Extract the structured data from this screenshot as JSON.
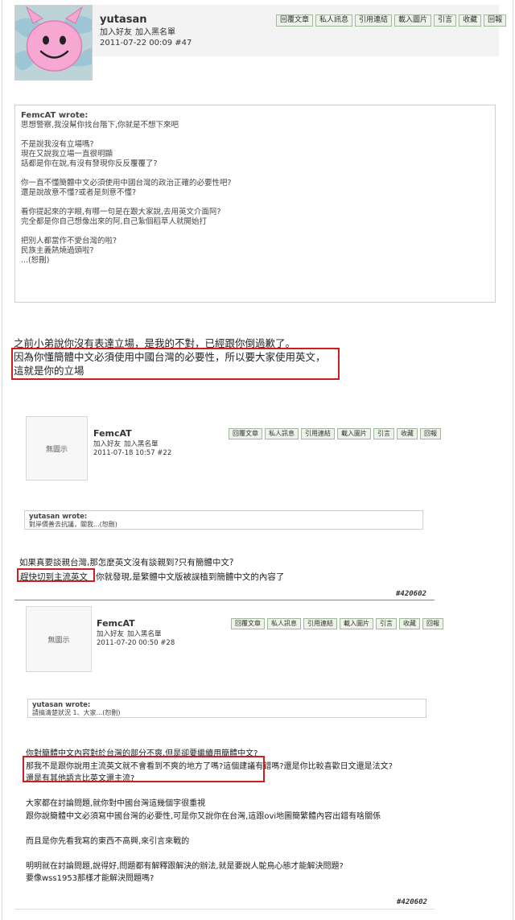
{
  "top_post": {
    "username": "yutasan",
    "add_friend": "加入好友",
    "add_blacklist": "加入黑名單",
    "meta": "2011-07-22 00:09 #47",
    "buttons": [
      "回覆文章",
      "私人訊息",
      "引用連結",
      "載入圖片",
      "引言",
      "收藏",
      "回報"
    ],
    "quote": {
      "author": "FemcAT wrote:",
      "lines": [
        "思想警察,我沒幫你找台階下,你就是不想下來吧",
        "",
        "不是說我沒有立場嗎?",
        "現在又說我立場一直很明顯",
        "話都是你在說,有沒有發現你反反覆覆了?",
        "",
        "你一直不懂簡體中文必須使用中國台灣的政治正確的必要性吧?",
        "還是說故意不懂?或者是刻意不懂?",
        "",
        "看你提起來的字眼,有哪一句是在跟大家說,去用英文介面阿?",
        "完全都是你自己想像出來的阿,自己紮個稻草人就開始打",
        "",
        "把別人都當作不愛台灣的啦?",
        "民族主義熱燒過頭啦?",
        "...(恕刪)"
      ]
    },
    "body_lines": [
      "之前小弟說你沒有表達立場，是我的不對，已經跟你倒過歉了。",
      "因為你懂簡體中文必須使用中國台灣的必要性，所以要大家使用英文，",
      "這就是你的立場"
    ]
  },
  "post_2": {
    "avatar_placeholder": "無圖示",
    "username": "FemcAT",
    "add_friend": "加入好友",
    "add_blacklist": "加入黑名單",
    "meta": "2011-07-18 10:57 #22",
    "buttons": [
      "回覆文章",
      "私人訊息",
      "引用連結",
      "載入圖片",
      "引言",
      "收藏",
      "回報"
    ],
    "quote": {
      "author": "yutasan wrote:",
      "lines": [
        "對岸價善去抗議，關我...(恕刪)"
      ]
    },
    "body_lines": [
      "如果真要談親台灣,那怎麼英文沒有談親到?只有簡體中文?",
      "趕快切到主流英文",
      "你就發現,是繁體中文版被誤植到簡體中文的內容了"
    ],
    "post_id": "#420602"
  },
  "post_3": {
    "avatar_placeholder": "無圖示",
    "username": "FemcAT",
    "add_friend": "加入好友",
    "add_blacklist": "加入黑名單",
    "meta": "2011-07-20 00:50 #28",
    "buttons": [
      "回覆文章",
      "私人訊息",
      "引用連結",
      "載入圖片",
      "引言",
      "收藏",
      "回報"
    ],
    "quote": {
      "author": "yutasan wrote:",
      "lines": [
        "請搞清楚狀況 1、大家...(恕刪)"
      ]
    },
    "body_lines": [
      "你對簡體中文內容對於台灣的部分不爽,但是卻要繼續用簡體中文?",
      "那我不是跟你說用主流英文就不會看到不爽的地方了嗎?這個建議有錯嗎?還是你比較喜歡日文還是法文?",
      "還是有其他語言比英文還主流?",
      "",
      "大家都在討論問題,就你對中國台灣這幾個字很重視",
      "跟你說簡體中文必須寫中國台灣的必要性,可是你又說你在台灣,這跟ovi地圖簡繁體內容出錯有啥關係",
      "",
      "而且是你先看我寫的東西不高興,來引言來戰的",
      "",
      "明明就在討論問題,說得好,問題都有解釋跟解決的辦法,就是要說人鴕鳥心態才能解決問題?",
      "要像wss1953那樣才能解決問題嗎?"
    ],
    "post_id": "#420602"
  },
  "colors": {
    "highlight_border": "#d01c1c",
    "button_border": "#9fb99a",
    "button_bg": "#eef3ea",
    "header_bg": "#f3f3f3"
  },
  "icons": {
    "avatar_1": "pink-devil-avatar"
  }
}
